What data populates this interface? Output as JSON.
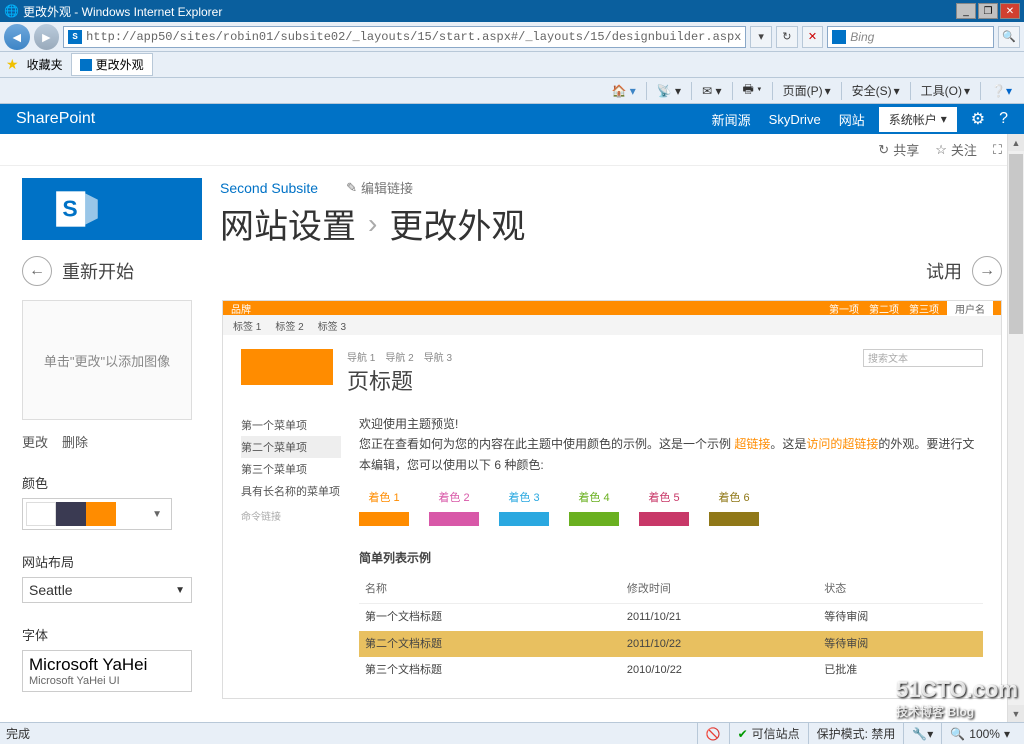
{
  "ie": {
    "title": "更改外观 - Windows Internet Explorer",
    "url": "http://app50/sites/robin01/subsite02/_layouts/15/start.aspx#/_layouts/15/designbuilder.aspx",
    "search_placeholder": "Bing",
    "fav_label": "收藏夹",
    "tab_title": "更改外观",
    "cmd": {
      "page": "页面(P)",
      "safety": "安全(S)",
      "tools": "工具(O)"
    },
    "status_done": "完成",
    "status_trusted": "可信站点",
    "status_protected": "保护模式: 禁用",
    "status_zoom": "100%"
  },
  "sp": {
    "brand": "SharePoint",
    "links": {
      "news": "新闻源",
      "skydrive": "SkyDrive",
      "sites": "网站"
    },
    "account": "系统帐户",
    "actions": {
      "share": "共享",
      "follow": "关注"
    },
    "crumb": "Second Subsite",
    "edit_link": "编辑链接",
    "page_settings": "网站设置",
    "page_sub": "更改外观",
    "restart": "重新开始",
    "tryit": "试用",
    "img_placeholder": "单击\"更改\"以添加图像",
    "img_change": "更改",
    "img_delete": "删除",
    "lbl_color": "颜色",
    "lbl_layout": "网站布局",
    "layout_value": "Seattle",
    "lbl_font": "字体",
    "font_main": "Microsoft YaHei",
    "font_sub": "Microsoft YaHei UI",
    "colors": {
      "c1": "#ffffff",
      "c2": "#3a3a52",
      "c3": "#ff8c00"
    }
  },
  "pv": {
    "brand": "品牌",
    "topnav": [
      "第一项",
      "第二项",
      "第三项"
    ],
    "user": "用户名",
    "tabs": [
      "标签 1",
      "标签 2",
      "标签 3"
    ],
    "breadcrumb": [
      "导航 1",
      "导航 2",
      "导航 3"
    ],
    "page_title": "页标题",
    "search": "搜索文本",
    "nav_items": [
      "第一个菜单项",
      "第二个菜单项",
      "第三个菜单项",
      "具有长名称的菜单项"
    ],
    "nav_cmd": "命令链接",
    "welcome": "欢迎使用主题预览!",
    "body1a": "您正在查看如何为您的内容在此主题中使用颜色的示例。这是一个示例",
    "body1b": "超链接",
    "body1c": "。这是",
    "body1d": "访问的超链接",
    "body1e": "的外观。要进行文本编辑，您可以使用以下 6 种颜色:",
    "swatches": [
      {
        "label": "着色 1",
        "color": "#ff8c00",
        "labelColor": "#ff8c00"
      },
      {
        "label": "着色 2",
        "color": "#d858a8",
        "labelColor": "#d858a8"
      },
      {
        "label": "着色 3",
        "color": "#2aa8e0",
        "labelColor": "#2aa8e0"
      },
      {
        "label": "着色 4",
        "color": "#6ab020",
        "labelColor": "#6ab020"
      },
      {
        "label": "着色 5",
        "color": "#c83868",
        "labelColor": "#c83868"
      },
      {
        "label": "着色 6",
        "color": "#907818",
        "labelColor": "#907818"
      }
    ],
    "table_title": "简单列表示例",
    "table_headers": [
      "名称",
      "修改时间",
      "状态"
    ],
    "table_rows": [
      {
        "name": "第一个文档标题",
        "date": "2011/10/21",
        "status": "等待审阅"
      },
      {
        "name": "第二个文档标题",
        "date": "2011/10/22",
        "status": "等待审阅",
        "sel": true
      },
      {
        "name": "第三个文档标题",
        "date": "2010/10/22",
        "status": "已批准"
      }
    ]
  },
  "watermark": {
    "main": "51CTO.com",
    "sub": "技术博客 Blog"
  }
}
